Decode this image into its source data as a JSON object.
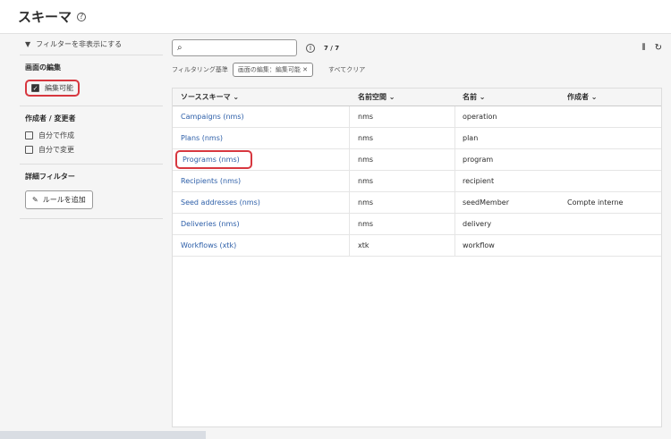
{
  "header": {
    "title": "スキーマ"
  },
  "sidebar": {
    "hide_filters": "フィルターを非表示にする",
    "sections": [
      {
        "title": "画面の編集",
        "options": [
          {
            "label": "編集可能",
            "checked": true
          }
        ]
      },
      {
        "title": "作成者 / 変更者",
        "options": [
          {
            "label": "自分で作成",
            "checked": false
          },
          {
            "label": "自分で変更",
            "checked": false
          }
        ]
      },
      {
        "title": "詳細フィルター",
        "add_rule": "ルールを追加"
      }
    ]
  },
  "main": {
    "search_placeholder": "",
    "count": "7 / 7",
    "filter_label": "フィルタリング基準",
    "chip": "画面の編集：編集可能",
    "clear_all": "すべてクリア",
    "columns": [
      "ソーススキーマ",
      "名前空間",
      "名前",
      "作成者"
    ],
    "rows": [
      [
        "Campaigns (nms)",
        "nms",
        "operation",
        ""
      ],
      [
        "Plans (nms)",
        "nms",
        "plan",
        ""
      ],
      [
        "Programs (nms)",
        "nms",
        "program",
        ""
      ],
      [
        "Recipients (nms)",
        "nms",
        "recipient",
        ""
      ],
      [
        "Seed addresses (nms)",
        "nms",
        "seedMember",
        "Compte interne"
      ],
      [
        "Deliveries (nms)",
        "nms",
        "delivery",
        ""
      ],
      [
        "Workflows (xtk)",
        "xtk",
        "workflow",
        ""
      ]
    ]
  },
  "colors": {
    "accent": "#2c5ea8",
    "highlight": "#d7373f"
  }
}
